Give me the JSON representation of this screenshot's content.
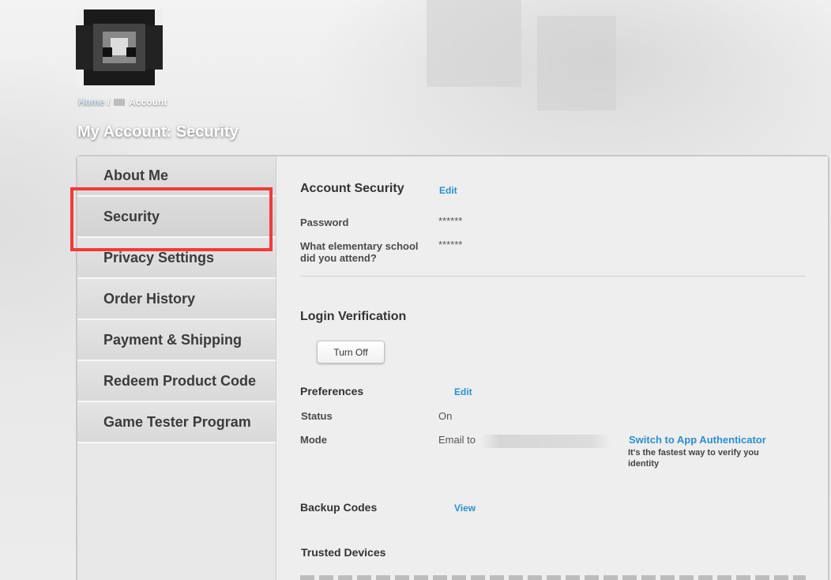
{
  "breadcrumb": {
    "home": "Home",
    "separator": "/",
    "current": "Account"
  },
  "page_title": "My Account: Security",
  "sidebar": {
    "items": [
      {
        "label": "About Me"
      },
      {
        "label": "Security"
      },
      {
        "label": "Privacy Settings"
      },
      {
        "label": "Order History"
      },
      {
        "label": "Payment & Shipping"
      },
      {
        "label": "Redeem Product Code"
      },
      {
        "label": "Game Tester Program"
      }
    ]
  },
  "account_security": {
    "heading": "Account Security",
    "edit_label": "Edit",
    "password_label": "Password",
    "password_value": "******",
    "question_label_1": "What elementary school",
    "question_label_2": "did you attend?",
    "question_value": "******"
  },
  "login_verification": {
    "heading": "Login Verification",
    "turn_off_label": "Turn Off"
  },
  "preferences": {
    "heading": "Preferences",
    "edit_label": "Edit",
    "status_label": "Status",
    "status_value": "On",
    "mode_label": "Mode",
    "mode_value": "Email to",
    "switch_link": "Switch to App Authenticator",
    "switch_hint": "It's the fastest way to verify you identity"
  },
  "backup_codes": {
    "heading": "Backup Codes",
    "view_label": "View"
  },
  "trusted_devices": {
    "heading": "Trusted Devices"
  },
  "colors": {
    "accent_link": "#2b8fd0",
    "highlight": "#f33a3a"
  }
}
